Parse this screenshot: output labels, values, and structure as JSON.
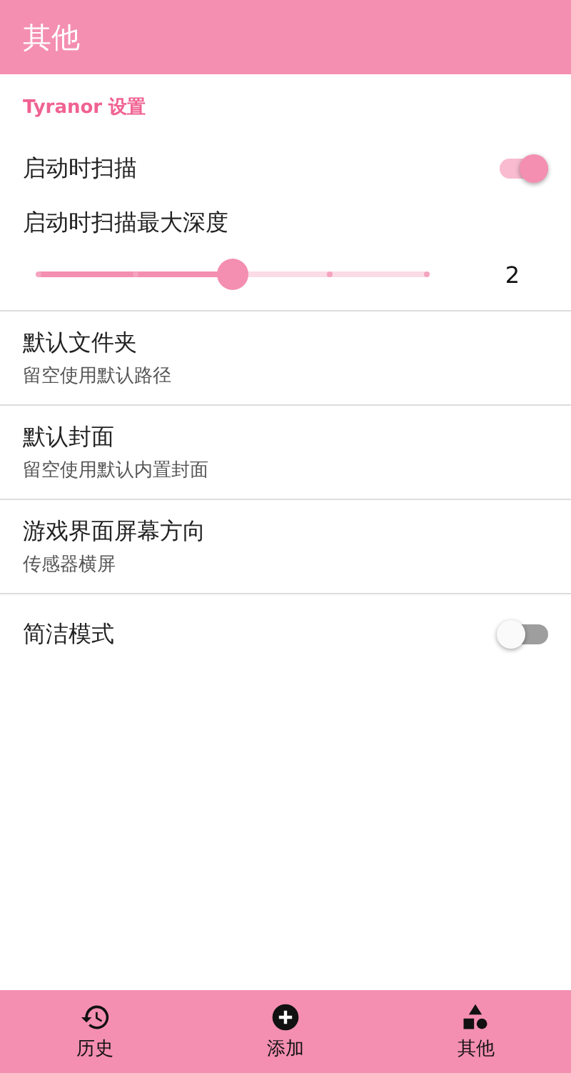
{
  "app_bar": {
    "title": "其他"
  },
  "section": {
    "title": "Tyranor 设置"
  },
  "settings": [
    {
      "kind": "switch",
      "label": "启动时扫描",
      "on": true
    },
    {
      "kind": "slider",
      "label": "启动时扫描最大深度",
      "level": 0.5,
      "reading": "2"
    },
    {
      "kind": "text",
      "label": "默认文件夹",
      "summary": "留空使用默认路径"
    },
    {
      "kind": "text",
      "label": "默认封面",
      "summary": "留空使用默认内置封面"
    },
    {
      "kind": "text",
      "label": "游戏界面屏幕方向",
      "summary": "传感器横屏"
    },
    {
      "kind": "switch",
      "label": "简洁模式",
      "on": false
    }
  ],
  "bottom_nav": [
    {
      "kind": "history",
      "label": "历史"
    },
    {
      "kind": "add",
      "label": "添加"
    },
    {
      "kind": "shapes",
      "label": "其他"
    }
  ]
}
